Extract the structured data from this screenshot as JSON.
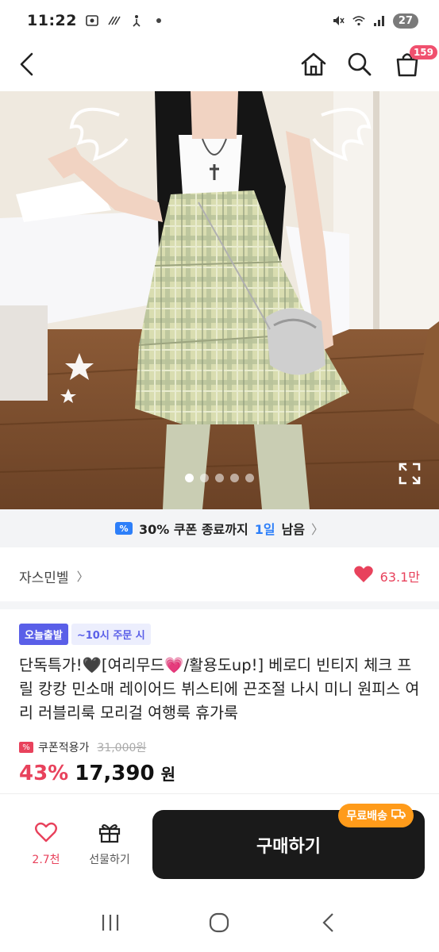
{
  "status_bar": {
    "time": "11:22",
    "battery": "27"
  },
  "nav": {
    "cart_count": "159"
  },
  "hero": {
    "dots_total": 5,
    "active_dot": 0
  },
  "coupon_banner": {
    "icon_text": "%",
    "text_before": "30% 쿠폰 종료까지",
    "highlight": "1일",
    "text_after": "남음",
    "chevron": "〉"
  },
  "shop": {
    "name": "자스민벨",
    "chevron": "〉",
    "likes": "63.1만"
  },
  "product": {
    "badge_today": "오늘출발",
    "badge_order": "~10시 주문 시",
    "title": "단독특가!🖤[여리무드💗/활용도up!] 베로디 빈티지 체크 프릴 캉캉 민소매 레이어드 뷔스티에 끈조절 나시 미니 원피스 여리 러블리룩 모리걸 여행룩 휴가룩",
    "coupon_label": "쿠폰적용가",
    "coupon_icon_text": "%",
    "original_price": "31,000원",
    "discount": "43%",
    "price": "17,390",
    "won": "원"
  },
  "actions": {
    "wish_count": "2.7천",
    "gift_label": "선물하기",
    "buy_label": "구매하기",
    "free_shipping": "무료배송"
  },
  "colors": {
    "accent_pink": "#e8425c",
    "accent_blue": "#2d7ff9",
    "badge_purple": "#5a5fe8",
    "free_ship_orange": "#ff9b1a"
  }
}
